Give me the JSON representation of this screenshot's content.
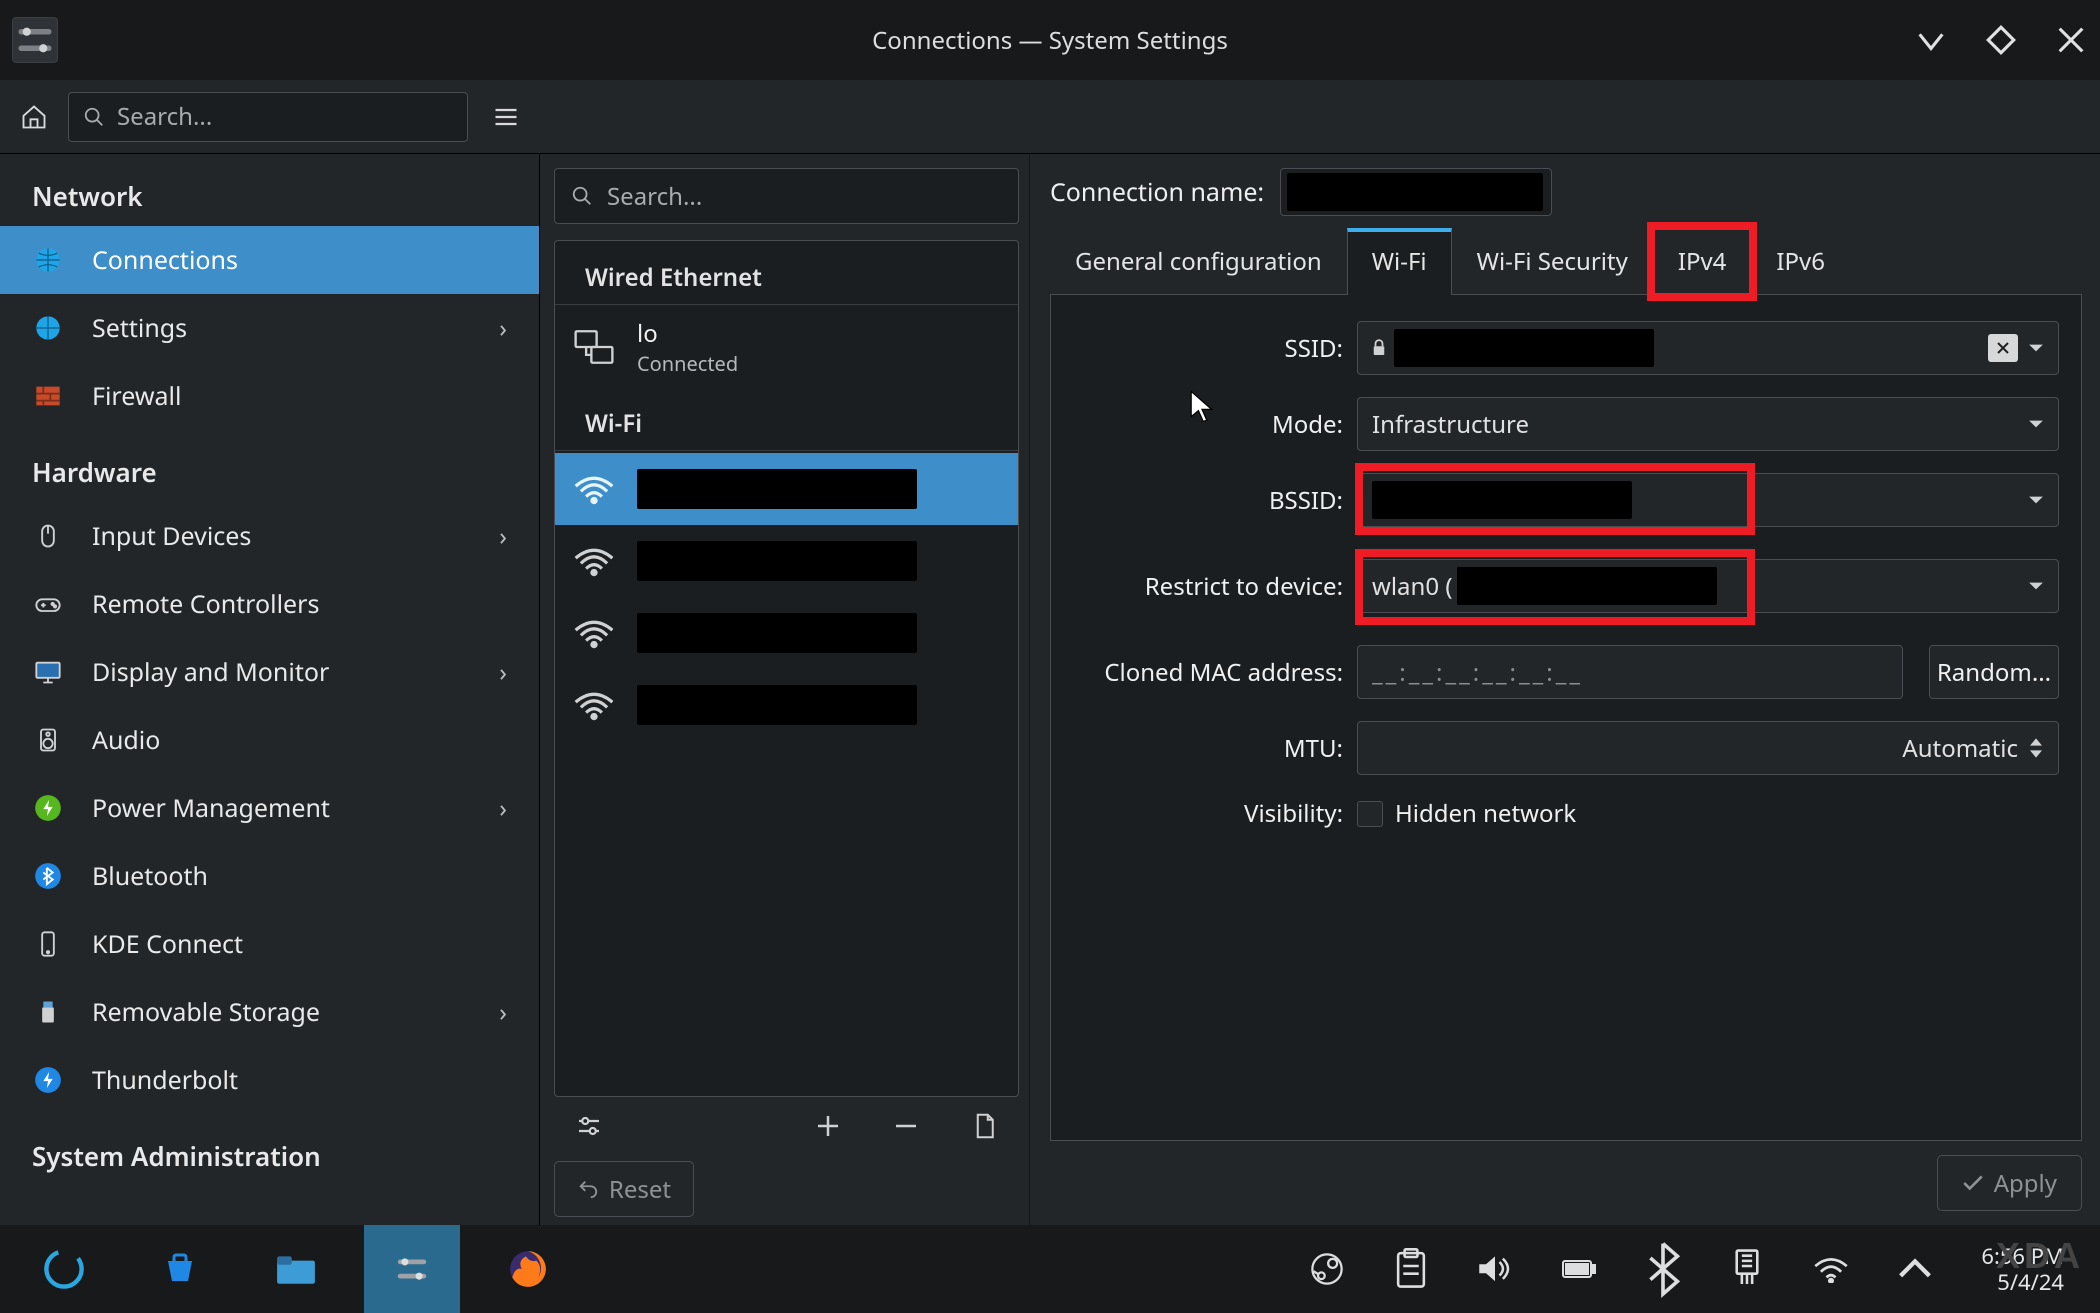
{
  "window": {
    "title": "Connections — System Settings"
  },
  "toolbar": {
    "search_placeholder": "Search..."
  },
  "sidebar": {
    "groups": [
      {
        "title": "Network",
        "items": [
          {
            "label": "Connections",
            "icon": "globe-icon",
            "active": true
          },
          {
            "label": "Settings",
            "icon": "globe-icon",
            "chevron": true
          },
          {
            "label": "Firewall",
            "icon": "firewall-icon"
          }
        ]
      },
      {
        "title": "Hardware",
        "items": [
          {
            "label": "Input Devices",
            "icon": "mouse-icon",
            "chevron": true
          },
          {
            "label": "Remote Controllers",
            "icon": "gamepad-icon"
          },
          {
            "label": "Display and Monitor",
            "icon": "monitor-icon",
            "chevron": true
          },
          {
            "label": "Audio",
            "icon": "speaker-icon"
          },
          {
            "label": "Power Management",
            "icon": "battery-icon",
            "chevron": true
          },
          {
            "label": "Bluetooth",
            "icon": "bluetooth-icon"
          },
          {
            "label": "KDE Connect",
            "icon": "phone-icon"
          },
          {
            "label": "Removable Storage",
            "icon": "usb-icon",
            "chevron": true
          },
          {
            "label": "Thunderbolt",
            "icon": "thunderbolt-icon"
          }
        ]
      },
      {
        "title": "System Administration",
        "items": []
      }
    ]
  },
  "mid": {
    "search_placeholder": "Search...",
    "sections": [
      {
        "title": "Wired Ethernet",
        "items": [
          {
            "name": "lo",
            "sub": "Connected",
            "icon": "ethernet-icon"
          }
        ]
      },
      {
        "title": "Wi-Fi",
        "items": [
          {
            "name": "",
            "icon": "wifi-icon",
            "active": true
          },
          {
            "name": "",
            "icon": "wifi-icon"
          },
          {
            "name": "",
            "icon": "wifi-icon"
          },
          {
            "name": "",
            "icon": "wifi-icon"
          }
        ]
      }
    ],
    "reset_label": "Reset"
  },
  "detail": {
    "name_label": "Connection name:",
    "tabs": [
      {
        "label": "General configuration"
      },
      {
        "label": "Wi-Fi",
        "active": true
      },
      {
        "label": "Wi-Fi Security"
      },
      {
        "label": "IPv4",
        "highlight": true
      },
      {
        "label": "IPv6"
      }
    ],
    "fields": {
      "ssid_label": "SSID:",
      "mode_label": "Mode:",
      "mode_value": "Infrastructure",
      "bssid_label": "BSSID:",
      "restrict_label": "Restrict to device:",
      "restrict_value": "wlan0 (",
      "mac_label": "Cloned MAC address:",
      "mac_placeholder": "__:__:__:__:__:__",
      "random_label": "Random...",
      "mtu_label": "MTU:",
      "mtu_value": "Automatic",
      "visibility_label": "Visibility:",
      "hidden_label": "Hidden network"
    },
    "apply_label": "Apply"
  },
  "taskbar": {
    "time": "6:56 PM",
    "date": "5/4/24"
  }
}
